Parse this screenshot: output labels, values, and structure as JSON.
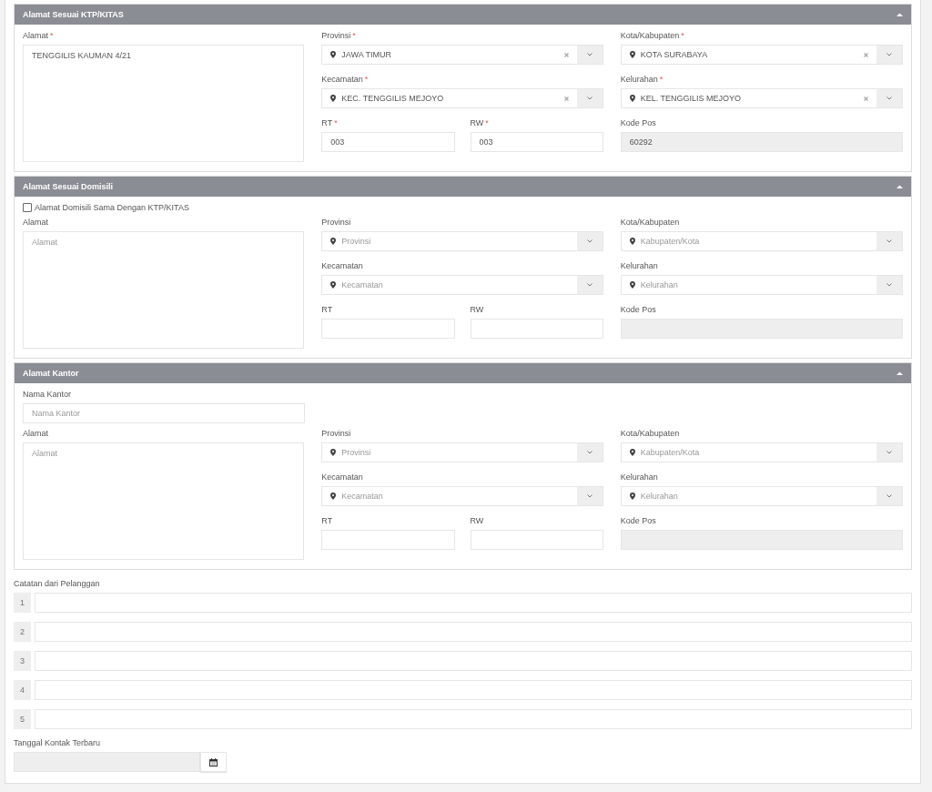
{
  "sections": [
    {
      "title": "Alamat Sesuai KTP/KITAS",
      "expanded": true,
      "address": {
        "label": "Alamat",
        "required_mark": "*",
        "value": "TENGGILIS KAUMAN 4/21"
      },
      "selects": [
        {
          "label": "Provinsi",
          "required_mark": "*",
          "value": "JAWA TIMUR"
        },
        {
          "label": "Kota/Kabupaten",
          "required_mark": "*",
          "value": "KOTA SURABAYA"
        },
        {
          "label": "Kecamatan",
          "required_mark": "*",
          "value": "KEC. TENGGILIS MEJOYO"
        },
        {
          "label": "Kelurahan",
          "required_mark": "*",
          "value": "KEL. TENGGILIS MEJOYO"
        }
      ],
      "rt": {
        "label": "RT",
        "required_mark": "*",
        "value": "003"
      },
      "rw": {
        "label": "RW",
        "required_mark": "*",
        "value": "003"
      },
      "kode_pos": {
        "label": "Kode Pos",
        "value": "60292",
        "disabled": true
      }
    },
    {
      "title": "Alamat Sesuai Domisili",
      "expanded": true,
      "checkbox": {
        "label": "Alamat Domisili Sama Dengan KTP/KITAS",
        "checked": false
      },
      "address": {
        "label": "Alamat",
        "placeholder": "Alamat"
      },
      "selects": [
        {
          "label": "Provinsi",
          "placeholder": "Provinsi"
        },
        {
          "label": "Kota/Kabupaten",
          "placeholder": "Kabupaten/Kota"
        },
        {
          "label": "Kecamatan",
          "placeholder": "Kecamatan"
        },
        {
          "label": "Kelurahan",
          "placeholder": "Kelurahan"
        }
      ],
      "rt": {
        "label": "RT"
      },
      "rw": {
        "label": "RW"
      },
      "kode_pos": {
        "label": "Kode Pos",
        "disabled": true
      }
    },
    {
      "title": "Alamat Kantor",
      "expanded": true,
      "office_name": {
        "label": "Nama Kantor",
        "placeholder": "Nama Kantor"
      },
      "address": {
        "label": "Alamat",
        "placeholder": "Alamat"
      },
      "selects": [
        {
          "label": "Provinsi",
          "placeholder": "Provinsi"
        },
        {
          "label": "Kota/Kabupaten",
          "placeholder": "Kabupaten/Kota"
        },
        {
          "label": "Kecamatan",
          "placeholder": "Kecamatan"
        },
        {
          "label": "Kelurahan",
          "placeholder": "Kelurahan"
        }
      ],
      "rt": {
        "label": "RT"
      },
      "rw": {
        "label": "RW"
      },
      "kode_pos": {
        "label": "Kode Pos",
        "disabled": true
      }
    }
  ],
  "notes": {
    "label": "Catatan dari Pelanggan",
    "rows": [
      {
        "number": "1"
      },
      {
        "number": "2"
      },
      {
        "number": "3"
      },
      {
        "number": "4"
      },
      {
        "number": "5"
      }
    ]
  },
  "last_contact": {
    "label": "Tanggal Kontak Terbaru",
    "disabled": true
  }
}
